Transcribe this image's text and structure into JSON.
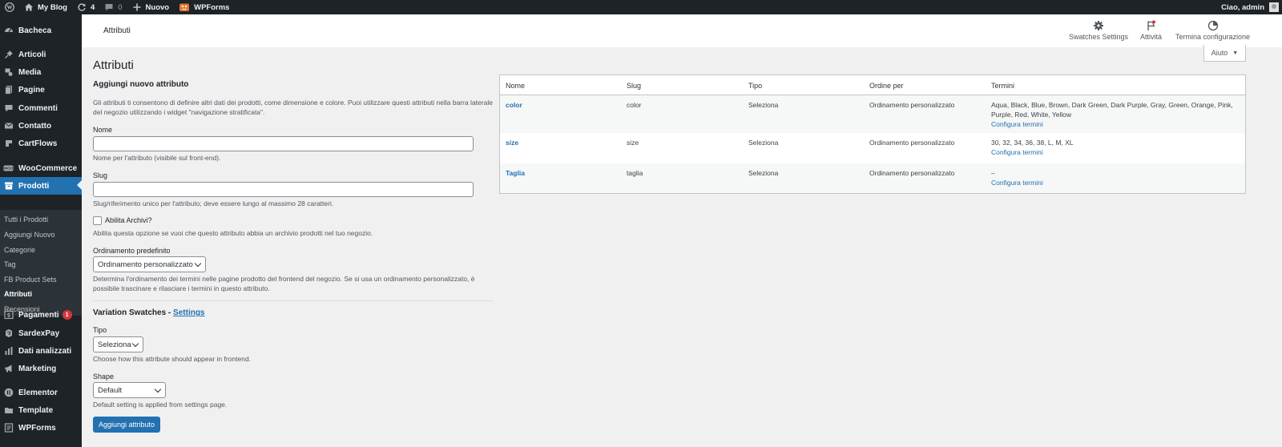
{
  "adminbar": {
    "site_name": "My Blog",
    "updates_count": "4",
    "comments_count": "0",
    "new_label": "Nuovo",
    "wpforms_label": "WPForms",
    "greeting": "Ciao, admin"
  },
  "sidebar": {
    "items": [
      {
        "label": "Bacheca",
        "icon": "dashboard-icon"
      },
      {
        "label": "Articoli",
        "icon": "pin-icon"
      },
      {
        "label": "Media",
        "icon": "media-icon"
      },
      {
        "label": "Pagine",
        "icon": "pages-icon"
      },
      {
        "label": "Commenti",
        "icon": "comments-icon"
      },
      {
        "label": "Contatto",
        "icon": "mail-icon"
      },
      {
        "label": "CartFlows",
        "icon": "cartflows-icon"
      },
      {
        "label": "WooCommerce",
        "icon": "woocommerce-icon"
      },
      {
        "label": "Prodotti",
        "icon": "archive-icon"
      },
      {
        "label": "Pagamenti",
        "icon": "payments-icon",
        "badge": "1"
      },
      {
        "label": "SardexPay",
        "icon": "sardexpay-icon"
      },
      {
        "label": "Dati analizzati",
        "icon": "chart-bar-icon"
      },
      {
        "label": "Marketing",
        "icon": "megaphone-icon"
      },
      {
        "label": "Elementor",
        "icon": "elementor-icon"
      },
      {
        "label": "Template",
        "icon": "folder-icon"
      },
      {
        "label": "WPForms",
        "icon": "wpforms-icon"
      }
    ],
    "submenu": [
      "Tutti i Prodotti",
      "Aggiungi Nuovo",
      "Categorie",
      "Tag",
      "FB Product Sets",
      "Attributi",
      "Recensioni"
    ]
  },
  "header": {
    "title": "Attributi",
    "buttons": [
      {
        "label": "Swatches Settings",
        "icon": "gear-icon"
      },
      {
        "label": "Attività",
        "icon": "flag-icon"
      },
      {
        "label": "Termina configurazione",
        "icon": "progress-circle-icon"
      }
    ],
    "help_label": "Aiuto"
  },
  "page": {
    "title": "Attributi"
  },
  "form": {
    "heading": "Aggiungi nuovo attributo",
    "intro": "Gli attributi ti consentono di definire altri dati dei prodotti, come dimensione e colore. Puoi utilizzare questi attributi nella barra laterale del negozio utilizzando i widget \"navigazione stratificata\".",
    "name_label": "Nome",
    "name_value": "",
    "name_desc": "Nome per l'attributo (visibile sul front-end).",
    "slug_label": "Slug",
    "slug_value": "",
    "slug_desc": "Slug/riferimento unico per l'attributo; deve essere lungo al massimo 28 caratteri.",
    "archive_label": "Abilita Archivi?",
    "archive_checked": false,
    "archive_desc": "Abilita questa opzione se vuoi che questo attributo abbia un archivio prodotti nel tuo negozio.",
    "order_label": "Ordinamento predefinito",
    "order_value": "Ordinamento personalizzato",
    "order_desc": "Determina l'ordinamento dei termini nelle pagine prodotto del frontend del negozio. Se si usa un ordinamento personalizzato, è possibile trascinare e rilasciare i termini in questo attributo.",
    "swatches_heading": "Variation Swatches -",
    "swatches_link": "Settings",
    "type_label": "Tipo",
    "type_value": "Seleziona",
    "type_desc": "Choose how this attribute should appear in frontend.",
    "shape_label": "Shape",
    "shape_value": "Default",
    "shape_desc": "Default setting is applied from settings page.",
    "submit_label": "Aggiungi attributo"
  },
  "table": {
    "headers": [
      "Nome",
      "Slug",
      "Tipo",
      "Ordine per",
      "Termini"
    ],
    "rows": [
      {
        "name": "color",
        "slug": "color",
        "type": "Seleziona",
        "order": "Ordinamento personalizzato",
        "terms": "Aqua, Black, Blue, Brown, Dark Green, Dark Purple, Gray, Green, Orange, Pink, Purple, Red, White, Yellow",
        "configure": "Configura termini"
      },
      {
        "name": "size",
        "slug": "size",
        "type": "Seleziona",
        "order": "Ordinamento personalizzato",
        "terms": "30, 32, 34, 36, 38, L, M, XL",
        "configure": "Configura termini"
      },
      {
        "name": "Taglia",
        "slug": "taglia",
        "type": "Seleziona",
        "order": "Ordinamento personalizzato",
        "terms": "–",
        "configure": "Configura termini"
      }
    ]
  },
  "colors": {
    "admin_dark": "#1d2327",
    "accent": "#2271b1",
    "badge": "#d63638",
    "background": "#f0f0f1"
  }
}
